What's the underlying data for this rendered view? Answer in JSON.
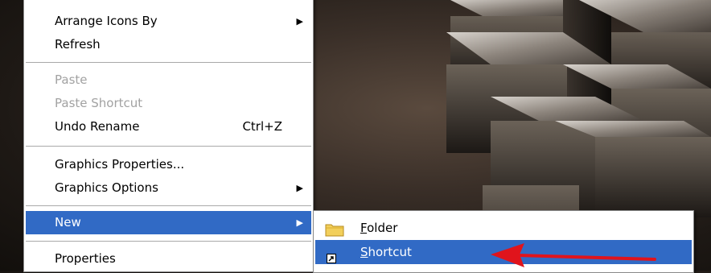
{
  "context_menu": {
    "items": [
      {
        "label": "Arrange Icons By",
        "has_submenu": true
      },
      {
        "label": "Refresh"
      },
      {
        "label": "Paste",
        "disabled": true
      },
      {
        "label": "Paste Shortcut",
        "disabled": true
      },
      {
        "label": "Undo Rename",
        "shortcut": "Ctrl+Z"
      },
      {
        "label": "Graphics Properties..."
      },
      {
        "label": "Graphics Options",
        "has_submenu": true
      },
      {
        "label": "New",
        "has_submenu": true,
        "highlighted": true
      },
      {
        "label": "Properties"
      }
    ]
  },
  "new_submenu": {
    "items": [
      {
        "label_first": "F",
        "label_rest": "older",
        "icon": "folder-icon"
      },
      {
        "label_first": "S",
        "label_rest": "hortcut",
        "icon": "shortcut-icon",
        "highlighted": true
      }
    ]
  },
  "colors": {
    "highlight": "#316ac5",
    "disabled_text": "#a2a2a2",
    "annotation_arrow": "#e0141c"
  }
}
